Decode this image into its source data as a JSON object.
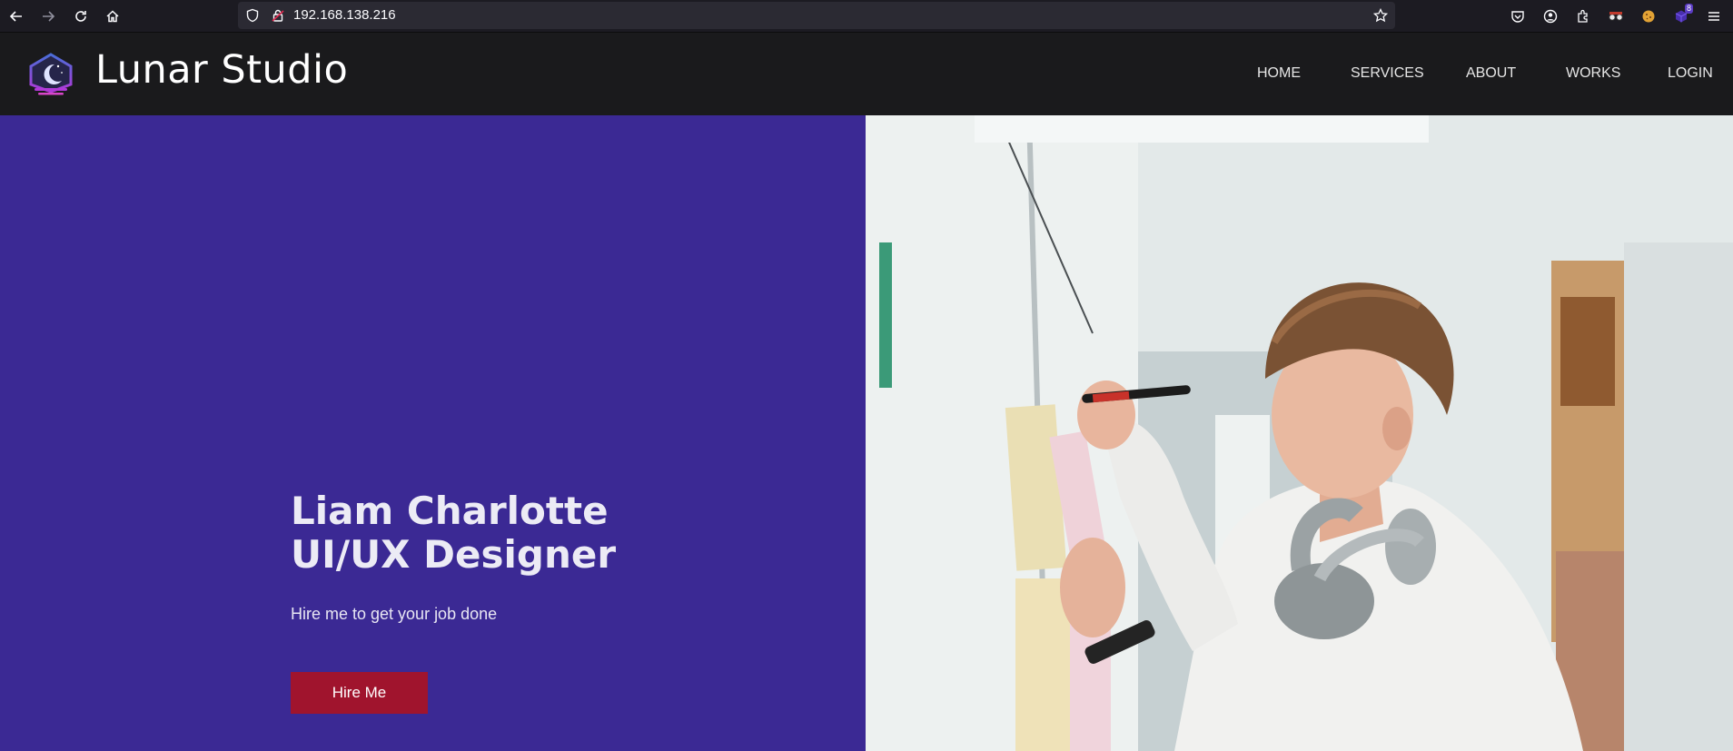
{
  "browser": {
    "url": "192.168.138.216",
    "extension_badge": "8",
    "icons": [
      "back-icon",
      "forward-icon",
      "reload-icon",
      "home-icon",
      "shield-icon",
      "lock-icon",
      "star-icon",
      "pocket-icon",
      "account-icon",
      "extensions-icon",
      "menu-icon"
    ]
  },
  "site": {
    "brand": "Lunar Studio",
    "nav": [
      "HOME",
      "SERVICES",
      "ABOUT",
      "WORKS",
      "LOGIN"
    ]
  },
  "hero": {
    "title_line1": "Liam Charlotte",
    "title_line2": "UI/UX Designer",
    "subtitle": "Hire me to get your job done",
    "cta": "Hire Me"
  },
  "colors": {
    "hero_bg": "#3b2994",
    "button_bg": "#a0142d",
    "header_bg": "#1a1a1c"
  }
}
